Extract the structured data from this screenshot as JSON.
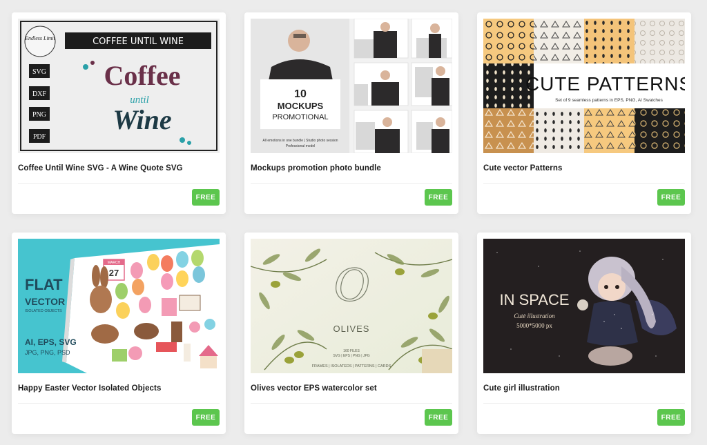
{
  "products": [
    {
      "title": "Coffee Until Wine SVG - A Wine Quote SVG",
      "badge": "FREE",
      "thumb": {
        "banner": "COFFEE UNTIL WINE",
        "logo": "Endless Limit",
        "formats": [
          "SVG",
          "DXF",
          "PNG",
          "PDF"
        ],
        "word_coffee": "Coffee",
        "word_until": "until",
        "word_wine": "Wine"
      }
    },
    {
      "title": "Mockups promotion photo bundle",
      "badge": "FREE",
      "thumb": {
        "number": "10",
        "heading": "MOCKUPS",
        "subheading": "PROMOTIONAL",
        "note1": "All emotions in one bundle | Studio photo session",
        "note2": "Professional model"
      }
    },
    {
      "title": "Cute vector Patterns",
      "badge": "FREE",
      "thumb": {
        "heading": "CUTE PATTERNS",
        "subheading": "Set of 9 seamless patterns in EPS, PNG, AI Swatches"
      }
    },
    {
      "title": "Happy Easter Vector Isolated Objects",
      "badge": "FREE",
      "thumb": {
        "line1": "FLAT",
        "line2": "VECTOR",
        "line3": "ISOLATED OBJECTS",
        "formats1": "AI, EPS, SVG",
        "formats2": "JPG, PNG, PSD",
        "calendar_month": "MARCH",
        "calendar_day": "27"
      }
    },
    {
      "title": "Olives vector EPS watercolor set",
      "badge": "FREE",
      "thumb": {
        "monogram": "O",
        "heading": "OLIVES",
        "files": "160 FILES",
        "formats": "SVG | EPS | PNG | JPG",
        "footer": "FRAMES | ISOLATEDS | PATTERNS | CARDS"
      }
    },
    {
      "title": "Cute girl illustration",
      "badge": "FREE",
      "thumb": {
        "heading": "IN SPACE",
        "subheading": "Cute illustration",
        "size": "5000*5000 px"
      }
    }
  ],
  "colors": {
    "page_bg": "#ececec",
    "card_bg": "#ffffff",
    "badge_green": "#5cc64e",
    "title_text": "#1b1b1b"
  }
}
